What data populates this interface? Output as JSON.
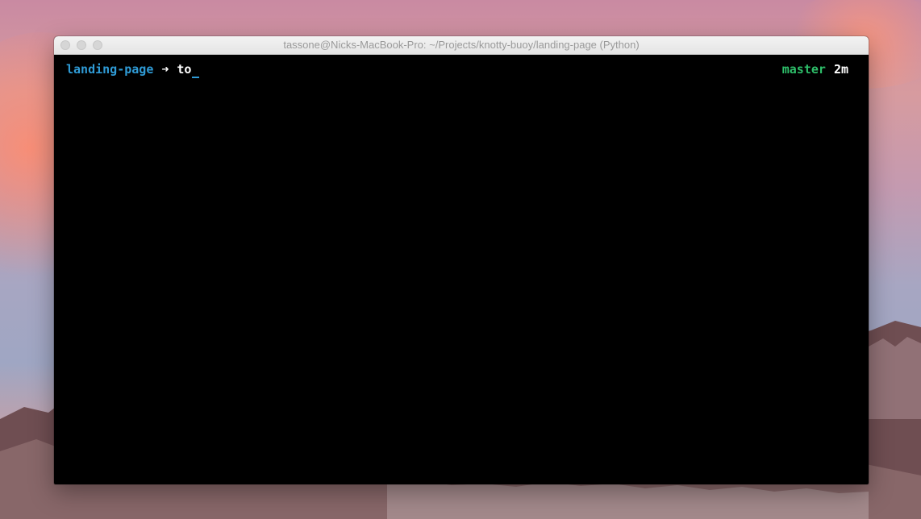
{
  "window": {
    "title": "tassone@Nicks-MacBook-Pro: ~/Projects/knotty-buoy/landing-page (Python)"
  },
  "terminal": {
    "cwd": "landing-page",
    "arrow": "➜",
    "command": "to",
    "git_branch": "master",
    "time_since": "2m"
  },
  "icons": {
    "close": "traffic-light-close",
    "minimize": "traffic-light-minimize",
    "zoom": "traffic-light-zoom"
  },
  "colors": {
    "cwd": "#2f9bd6",
    "branch": "#2ebf6a",
    "terminal_bg": "#000000"
  }
}
